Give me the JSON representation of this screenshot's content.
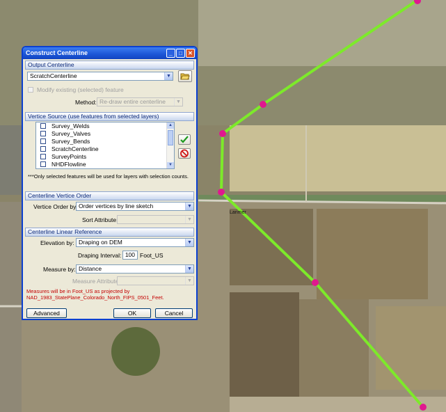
{
  "dialog": {
    "title": "Construct Centerline",
    "controls": {
      "minimize": "_",
      "maximize": "□",
      "close": "✕"
    }
  },
  "output": {
    "header": "Output Centerline",
    "layer_value": "ScratchCenterline",
    "modify_label": "Modify existing (selected) feature",
    "method_label": "Method:",
    "method_value": "Re-draw entire centerline"
  },
  "vertice_source": {
    "header": "Vertice Source (use features from selected layers)",
    "items": [
      "Survey_Welds",
      "Survey_Valves",
      "Survey_Bends",
      "ScratchCenterline",
      "SurveyPoints",
      "NHDFlowline"
    ],
    "note": "***Only selected features will be used for layers with selection counts."
  },
  "vertice_order": {
    "header": "Centerline Vertice Order",
    "order_label": "Vertice Order by:",
    "order_value": "Order vertices by line sketch",
    "sort_label": "Sort Attribute:",
    "sort_value": ""
  },
  "linear_ref": {
    "header": "Centerline Linear Reference",
    "elevation_label": "Elevation by:",
    "elevation_value": "Draping on DEM",
    "interval_label": "Draping Interval:",
    "interval_value": "100",
    "interval_unit": "Foot_US",
    "measure_label": "Measure by:",
    "measure_value": "Distance",
    "measure_attr_label": "Measure Attribute:",
    "measure_attr_value": "",
    "units_note_1": "Measures will be in Foot_US as projected by",
    "units_note_2": "NAD_1983_StatePlane_Colorado_North_FIPS_0501_Feet."
  },
  "buttons": {
    "advanced": "Advanced",
    "ok": "OK",
    "cancel": "Cancel"
  },
  "map": {
    "place_label": "Larimer",
    "line_color": "#7dea2a",
    "vertex_color": "#e0188f"
  },
  "icons": [
    "open-folder-icon",
    "apply-check-icon",
    "clear-cancel-icon"
  ]
}
